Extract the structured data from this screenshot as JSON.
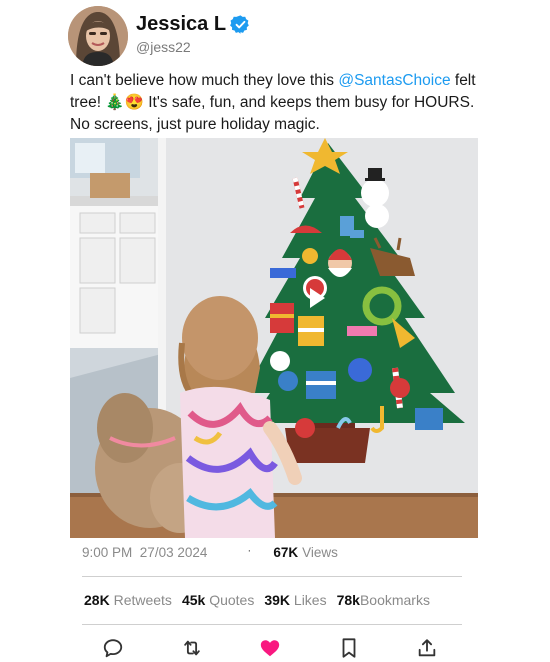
{
  "user": {
    "name": "Jessica L",
    "handle": "@jess22",
    "verified_color": "#1d9bf0"
  },
  "tweet": {
    "text_part1": "I can't believe how much they love this ",
    "mention": "@SantasChoice",
    "text_part2": " felt tree! 🎄😍 It's safe, fun, and keeps them busy for HOURS. No screens, just pure holiday magic."
  },
  "meta": {
    "time": "9:00 PM",
    "date": "27/03 2024",
    "views_count": "67K",
    "views_label": "Views"
  },
  "stats": {
    "retweets": {
      "num": "28K",
      "label": "Retweets"
    },
    "quotes": {
      "num": "45k",
      "label": "Quotes"
    },
    "likes": {
      "num": "39K",
      "label": "Likes"
    },
    "bookmarks": {
      "num": "78k",
      "label": "Bookmarks"
    }
  },
  "actions": {
    "reply_icon": "reply-icon",
    "retweet_icon": "retweet-icon",
    "like_icon": "heart-icon",
    "like_color": "#f91880",
    "bookmark_icon": "bookmark-icon",
    "share_icon": "share-icon"
  }
}
